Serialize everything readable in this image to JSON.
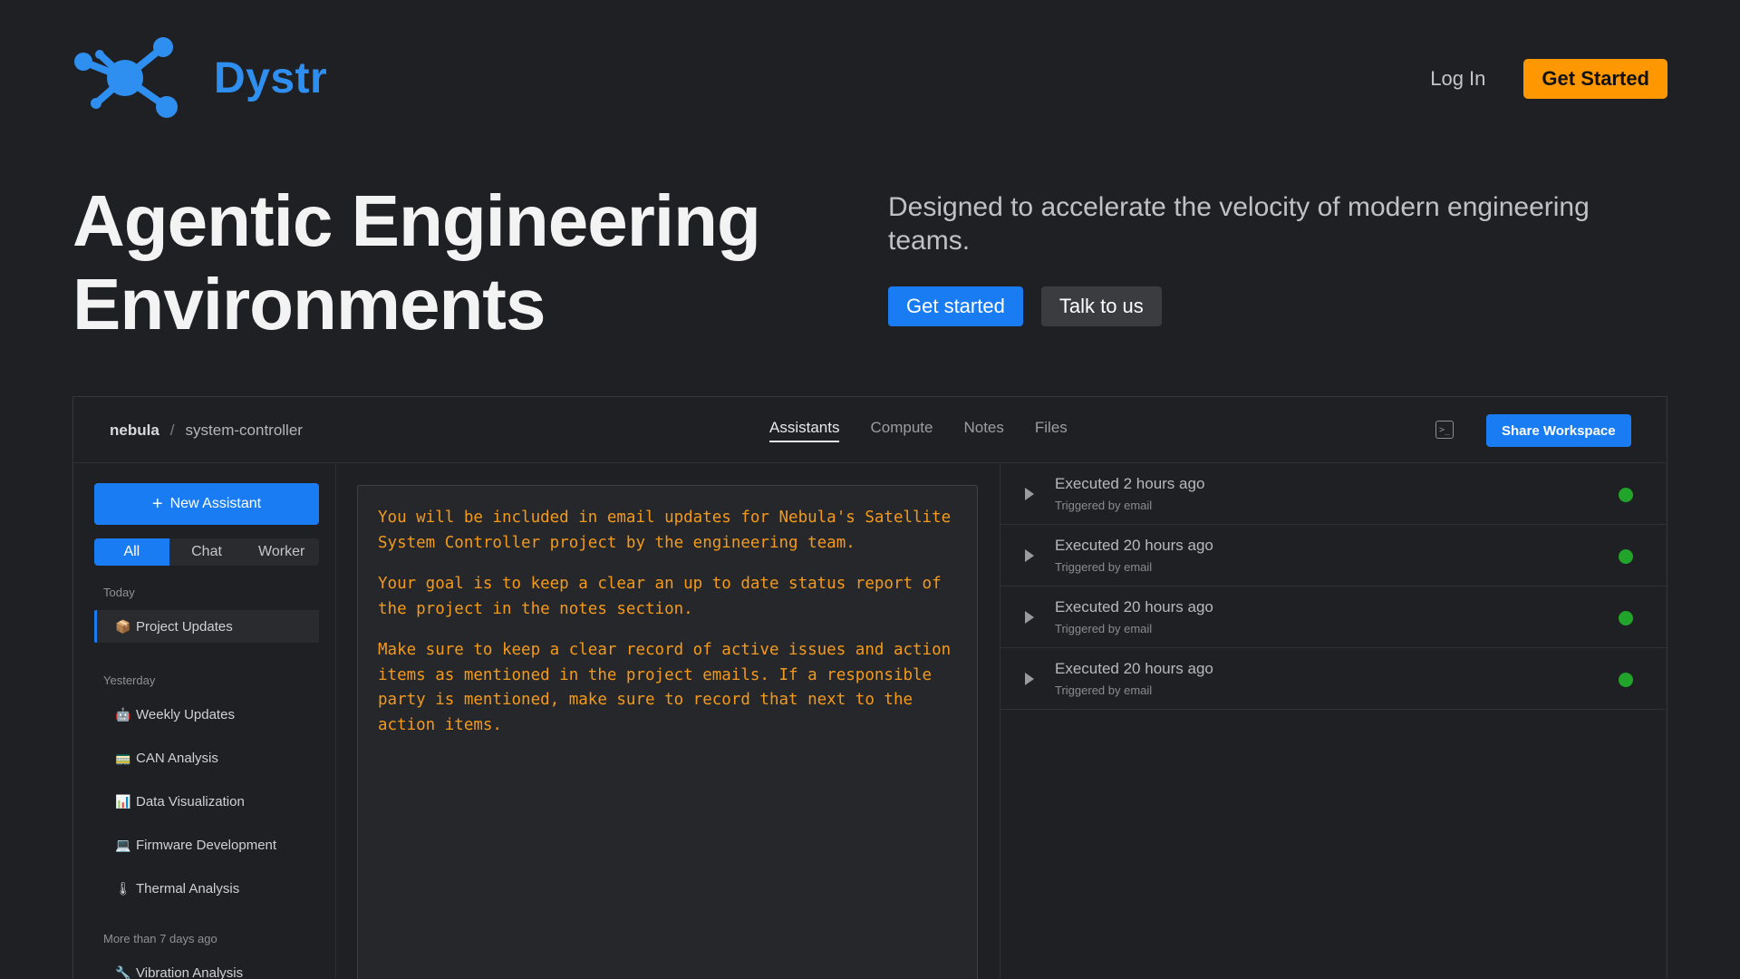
{
  "brand": {
    "name": "Dystr",
    "logo_icon": "molecule-icon",
    "color": "#2f8ff0"
  },
  "nav": {
    "login_label": "Log In",
    "get_started_label": "Get Started"
  },
  "hero": {
    "title_line1": "Agentic Engineering",
    "title_line2": "Environments",
    "subtitle": "Designed to accelerate the velocity of modern engineering teams.",
    "primary_cta": "Get started",
    "secondary_cta": "Talk to us"
  },
  "app": {
    "breadcrumb": {
      "workspace": "nebula",
      "separator": "/",
      "project": "system-controller"
    },
    "tabs": [
      {
        "label": "Assistants",
        "active": true
      },
      {
        "label": "Compute",
        "active": false
      },
      {
        "label": "Notes",
        "active": false
      },
      {
        "label": "Files",
        "active": false
      }
    ],
    "terminal_icon": "terminal-icon",
    "share_label": "Share Workspace",
    "sidebar": {
      "new_assistant_label": "New Assistant",
      "filters": [
        "All",
        "Chat",
        "Worker"
      ],
      "active_filter": "All",
      "groups": [
        {
          "label": "Today",
          "items": [
            {
              "icon": "📦",
              "label": "Project Updates",
              "active": true
            }
          ]
        },
        {
          "label": "Yesterday",
          "items": [
            {
              "icon": "🤖",
              "label": "Weekly Updates"
            },
            {
              "icon": "🚃",
              "label": "CAN Analysis"
            },
            {
              "icon": "📊",
              "label": "Data Visualization"
            },
            {
              "icon": "💻",
              "label": "Firmware Development"
            },
            {
              "icon": "🌡",
              "label": "Thermal Analysis"
            }
          ]
        },
        {
          "label": "More than 7 days ago",
          "items": [
            {
              "icon": "🔧",
              "label": "Vibration Analysis"
            }
          ]
        }
      ]
    },
    "prompt": [
      "You will be included in email updates for Nebula's Satellite System Controller project by the engineering team.",
      "Your goal is to keep a clear an up to date status report of the project in the notes section.",
      "Make sure to keep a clear record of active issues and action items as mentioned in the project emails. If a responsible party is mentioned, make sure to record that next to the action items."
    ],
    "prompt_color": "#f39a1d",
    "runs": [
      {
        "title": "Executed 2 hours ago",
        "sub": "Triggered by email",
        "status": "success"
      },
      {
        "title": "Executed 20 hours ago",
        "sub": "Triggered by email",
        "status": "success"
      },
      {
        "title": "Executed 20 hours ago",
        "sub": "Triggered by email",
        "status": "success"
      },
      {
        "title": "Executed 20 hours ago",
        "sub": "Triggered by email",
        "status": "success"
      }
    ],
    "status_color": "#22a32a"
  }
}
